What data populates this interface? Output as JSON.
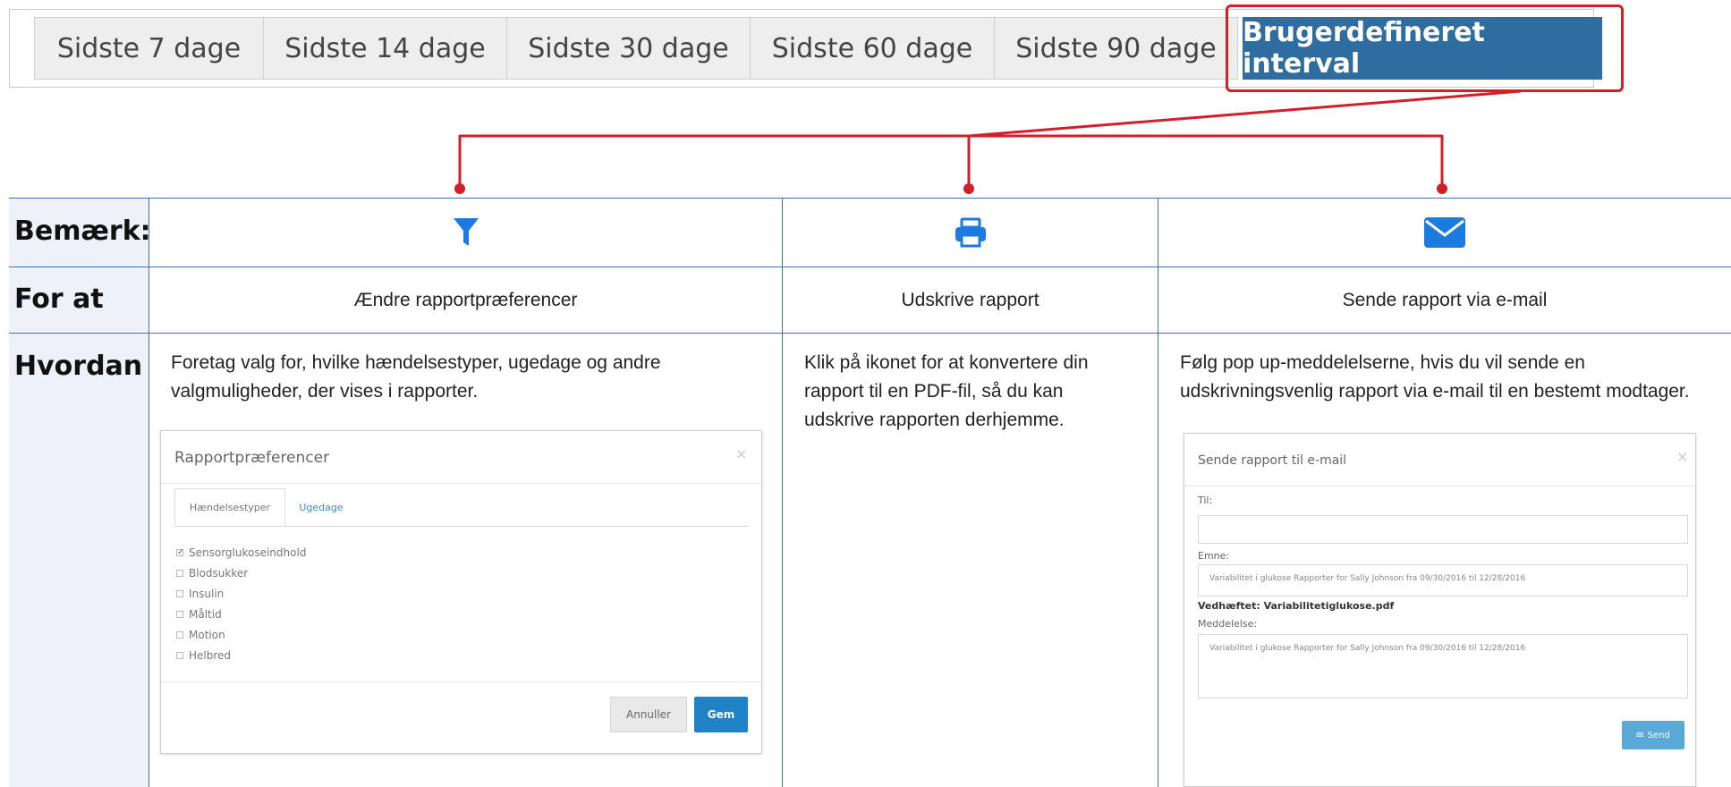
{
  "tabs": [
    {
      "label": "Sidste 7 dage",
      "active": false
    },
    {
      "label": "Sidste 14 dage",
      "active": false
    },
    {
      "label": "Sidste 30 dage",
      "active": false
    },
    {
      "label": "Sidste 60 dage",
      "active": false
    },
    {
      "label": "Sidste 90 dage",
      "active": false
    },
    {
      "label": "Brugerdefineret interval",
      "active": true
    }
  ],
  "colors": {
    "active_tab": "#2f6c9f",
    "highlight": "#d0202a",
    "icon_blue": "#1d7be0",
    "grid_line": "#3b73b5",
    "label_column": "#eef1f8"
  },
  "table": {
    "row_labels": {
      "note": "Bemærk:",
      "purpose": "For at",
      "how": "Hvordan"
    },
    "columns": [
      {
        "icon": "filter-icon",
        "purpose": "Ændre rapportpræferencer",
        "how": "Foretag valg for, hvilke hændelsestyper, ugedage og andre valgmuligheder, der vises i rapporter."
      },
      {
        "icon": "print-icon",
        "purpose": "Udskrive rapport",
        "how": "Klik på ikonet for at konvertere din rapport til en PDF-fil, så du kan udskrive rapporten derhjemme."
      },
      {
        "icon": "envelope-icon",
        "purpose": "Sende rapport via e-mail",
        "how": "Følg pop up-meddelelserne, hvis du vil sende en udskrivningsvenlig rapport via e-mail til en bestemt modtager."
      }
    ]
  },
  "prefs_dialog": {
    "title": "Rapportpræferencer",
    "close": "×",
    "tabs": [
      "Hændelsestyper",
      "Ugedage"
    ],
    "items": [
      {
        "label": "Sensorglukoseindhold",
        "checked": true
      },
      {
        "label": "Blodsukker",
        "checked": false
      },
      {
        "label": "Insulin",
        "checked": false
      },
      {
        "label": "Måltid",
        "checked": false
      },
      {
        "label": "Motion",
        "checked": false
      },
      {
        "label": "Helbred",
        "checked": false
      }
    ],
    "cancel": "Annuller",
    "save": "Gem"
  },
  "email_dialog": {
    "title": "Sende rapport til e-mail",
    "close": "×",
    "to_label": "Til:",
    "subject_label": "Emne:",
    "subject_value": "Variabilitet i glukose Rapporter for Sally Johnson fra 09/30/2016 til 12/28/2016",
    "attachment": "Vedhæftet: Variabilitetiglukose.pdf",
    "message_label": "Meddelelse:",
    "message_value": "Variabilitet i glukose Rapporter for Sally Johnson fra 09/30/2016 til 12/28/2016",
    "send": "Send"
  }
}
